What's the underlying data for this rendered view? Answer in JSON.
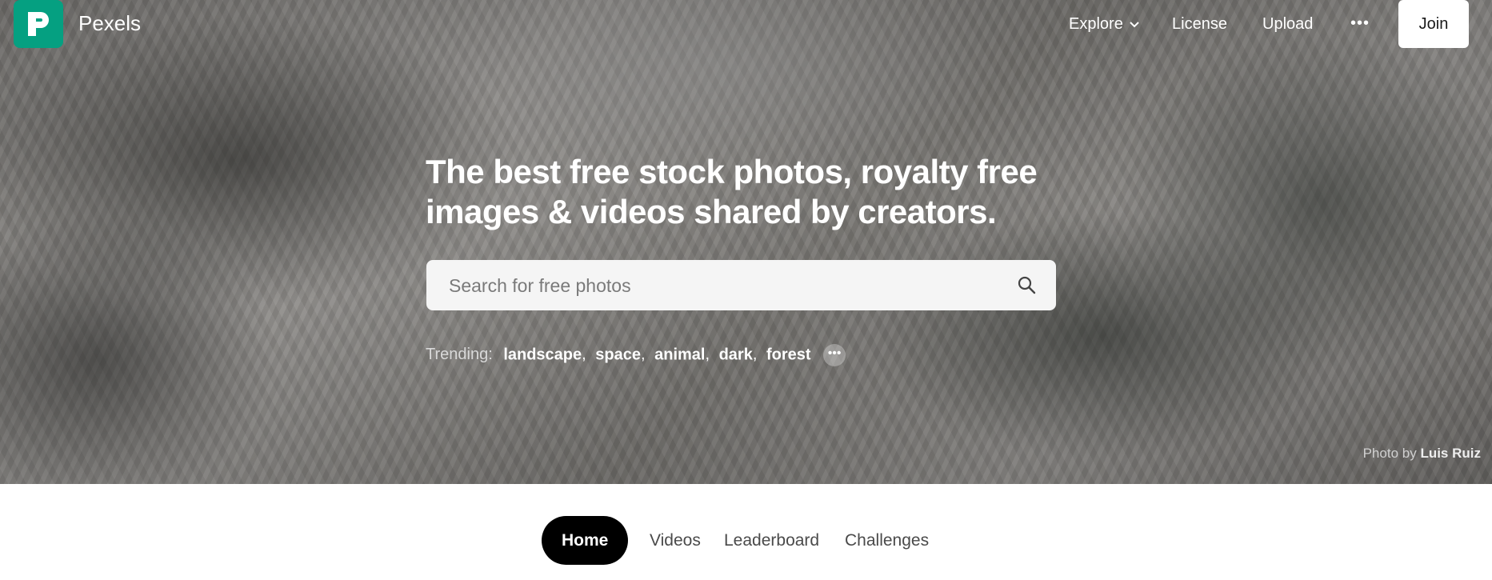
{
  "brand": {
    "name": "Pexels",
    "logo_color": "#05a081"
  },
  "nav": {
    "explore": "Explore",
    "license": "License",
    "upload": "Upload",
    "more_icon": "ellipsis-icon",
    "join": "Join"
  },
  "hero": {
    "headline_line1": "The best free stock photos, royalty free",
    "headline_line2": "images & videos shared by creators.",
    "search_placeholder": "Search for free photos",
    "trending_label": "Trending:",
    "trending": [
      "landscape",
      "space",
      "animal",
      "dark",
      "forest"
    ],
    "credit_label": "Photo by",
    "credit_name": "Luis Ruiz"
  },
  "tabs": [
    {
      "label": "Home",
      "active": true
    },
    {
      "label": "Videos",
      "active": false
    },
    {
      "label": "Leaderboard",
      "active": false
    },
    {
      "label": "Challenges",
      "active": false
    }
  ]
}
